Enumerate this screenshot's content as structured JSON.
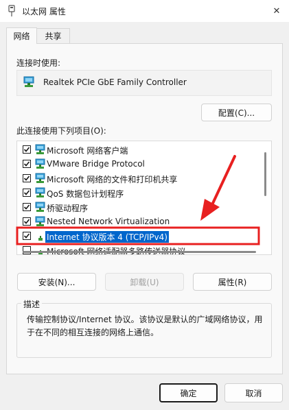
{
  "window": {
    "title": "以太网 属性",
    "close_label": "✕"
  },
  "tabs": [
    {
      "label": "网络",
      "active": true
    },
    {
      "label": "共享",
      "active": false
    }
  ],
  "connect_using": {
    "label": "连接时使用:",
    "adapter": "Realtek PCIe GbE Family Controller"
  },
  "configure_label": "配置(C)...",
  "items_label": "此连接使用下列项目(O):",
  "items": [
    {
      "label": "Microsoft 网络客户端",
      "checked": true,
      "icon": "network-client-icon"
    },
    {
      "label": "VMware Bridge Protocol",
      "checked": true,
      "icon": "network-protocol-icon"
    },
    {
      "label": "Microsoft 网络的文件和打印机共享",
      "checked": true,
      "icon": "network-service-icon"
    },
    {
      "label": "QoS 数据包计划程序",
      "checked": true,
      "icon": "network-service-icon"
    },
    {
      "label": "桥驱动程序",
      "checked": true,
      "icon": "network-protocol-icon"
    },
    {
      "label": "Nested Network Virtualization",
      "checked": true,
      "icon": "network-protocol-icon"
    },
    {
      "label": "Internet 协议版本 4 (TCP/IPv4)",
      "checked": true,
      "selected": true,
      "icon": "network-protocol-icon"
    },
    {
      "label": "Microsoft 网络适配器多路传送器协议",
      "checked": false,
      "icon": "network-protocol-icon"
    }
  ],
  "buttons": {
    "install": "安装(N)...",
    "uninstall": "卸载(U)",
    "properties": "属性(R)",
    "ok": "确定",
    "cancel": "取消"
  },
  "description": {
    "title": "描述",
    "text": "传输控制协议/Internet 协议。该协议是默认的广域网络协议，用于在不同的相互连接的网络上通信。"
  },
  "colors": {
    "selection": "#0066cc",
    "annotation_red": "#e82020",
    "accent": "#0066cc"
  }
}
